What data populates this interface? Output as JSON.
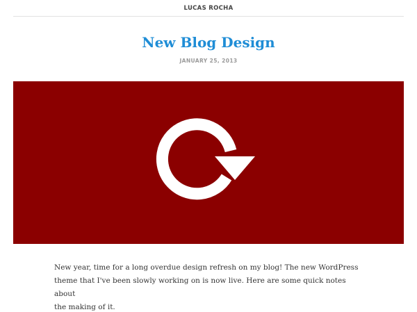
{
  "site": {
    "title": "LUCAS ROCHA"
  },
  "post": {
    "title": "New Blog Design",
    "date": "JANUARY 25, 2013",
    "hero": {
      "background_color": "#8b0000",
      "icon": "refresh-icon",
      "icon_color": "#ffffff"
    },
    "body_lines": [
      "New year, time for a long overdue design refresh on my blog! The new WordPress",
      "theme that I've been slowly working on is now live. Here are some quick notes about",
      "the making of it."
    ]
  },
  "colors": {
    "accent": "#1f8dd6",
    "text": "#333333",
    "muted": "#9a9a9a",
    "divider": "#e2e2e2"
  }
}
